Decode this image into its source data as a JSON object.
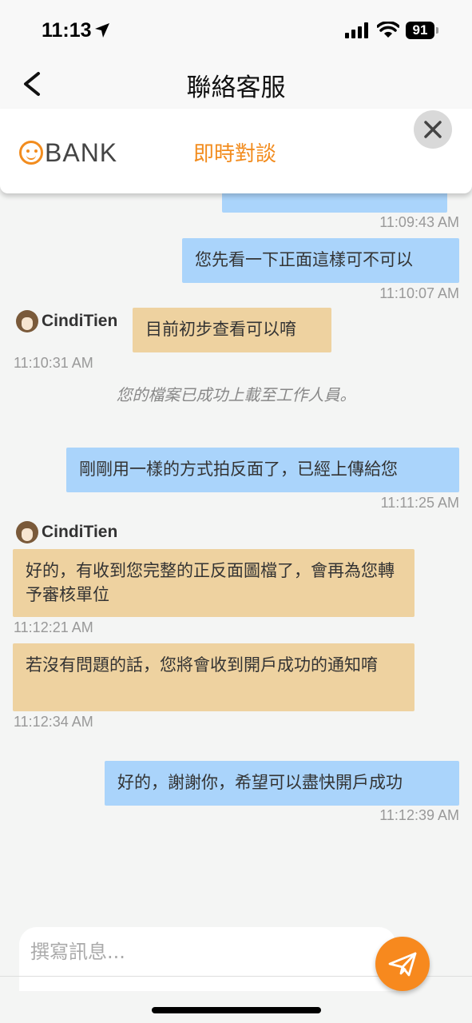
{
  "status_bar": {
    "time": "11:13",
    "battery": "91"
  },
  "nav": {
    "title": "聯絡客服"
  },
  "chat_header": {
    "logo_text": "BANK",
    "title": "即時對談"
  },
  "messages": [
    {
      "type": "me",
      "text": "",
      "time": "11:09:43 AM"
    },
    {
      "type": "me",
      "text": "您先看一下正面這樣可不可以",
      "time": "11:10:07 AM"
    },
    {
      "type": "agent",
      "name": "CindiTien",
      "text": "目前初步查看可以唷",
      "time": "11:10:31 AM"
    },
    {
      "type": "system",
      "text": "您的檔案已成功上載至工作人員。"
    },
    {
      "type": "me",
      "text": "剛剛用一樣的方式拍反面了，已經上傳給您",
      "time": "11:11:25 AM"
    },
    {
      "type": "agent",
      "name": "CindiTien",
      "text": "好的，有收到您完整的正反面圖檔了，會再為您轉予審核單位",
      "time": "11:12:21 AM"
    },
    {
      "type": "agent",
      "text": "若沒有問題的話，您將會收到開戶成功的通知唷",
      "time": "11:12:34 AM"
    },
    {
      "type": "me",
      "text": "好的，謝謝你，希望可以盡快開戶成功",
      "time": "11:12:39 AM"
    }
  ],
  "composer": {
    "placeholder": "撰寫訊息..."
  },
  "colors": {
    "accent": "#f7891e",
    "me_bubble": "#aad4fb",
    "agent_bubble": "#eed2a0"
  },
  "icons": {
    "back": "chevron-left-icon",
    "close": "close-icon",
    "send": "paper-plane-icon"
  }
}
